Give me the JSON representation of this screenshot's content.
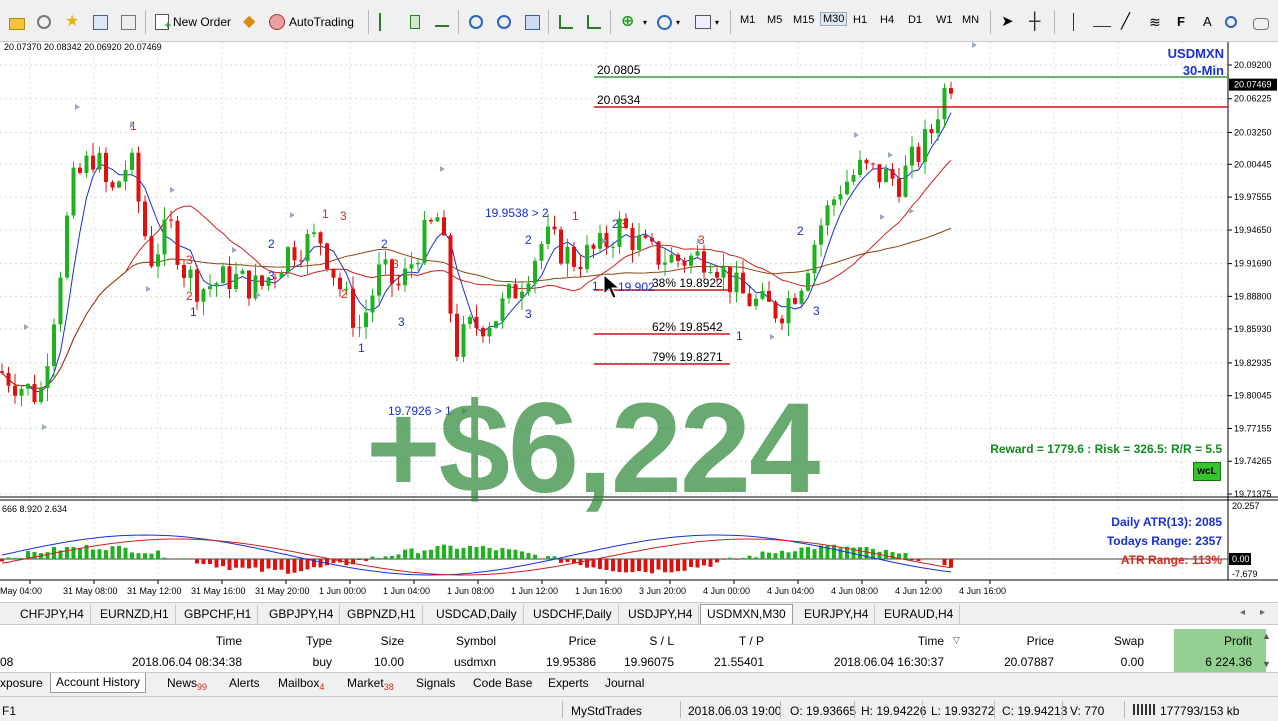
{
  "toolbar": {
    "new_order_label": "New Order",
    "autotrading_label": "AutoTrading",
    "timeframes": [
      "M1",
      "M5",
      "M15",
      "M30",
      "H1",
      "H4",
      "D1",
      "W1",
      "MN"
    ],
    "selected_timeframe": "M30"
  },
  "chart": {
    "ohlc_header": "20.07370 20.08342 20.06920 20.07469",
    "symbol": "USDMXN",
    "timeframe_label": "30-Min",
    "current_price_tag": "20.07469",
    "price_axis": [
      "20.09200",
      "20.06225",
      "20.03250",
      "20.00445",
      "19.97555",
      "19.94650",
      "19.91690",
      "19.88800",
      "19.85930",
      "19.82935",
      "19.80045",
      "19.77155",
      "19.74265",
      "19.71375"
    ],
    "time_axis": [
      "31 May 04:00",
      "31 May 08:00",
      "31 May 12:00",
      "31 May 16:00",
      "31 May 20:00",
      "1 Jun 00:00",
      "1 Jun 04:00",
      "1 Jun 08:00",
      "1 Jun 12:00",
      "1 Jun 16:00",
      "3 Jun 20:00",
      "4 Jun 00:00",
      "4 Jun 04:00",
      "4 Jun 08:00",
      "4 Jun 12:00",
      "4 Jun 16:00"
    ],
    "level_tp": "20.0805",
    "level_entry": "20.0534",
    "fib_38": "38% 19.8922",
    "fib_62": "62% 19.8542",
    "fib_79": "79% 19.8271",
    "label_high": "19.9538 > 2",
    "label_low": "19.7926 > 1",
    "label_mid": "19.902",
    "profit_overlay": "+$6,224",
    "reward_risk": "Reward = 1779.6 : Risk = 326.5: R/R = 5.5",
    "badge": "wcL",
    "atr_line1": "Daily ATR(13): 2085",
    "atr_line2": "Todays Range: 2357",
    "atr_line3": "ATR Range: 113%",
    "indicator_label": "666 8.920 2.634",
    "indicator_axis": [
      "20.257",
      "0.00",
      "-7.679"
    ],
    "wave_labels": [
      {
        "t": "1",
        "c": "red"
      },
      {
        "t": "2",
        "c": "red"
      },
      {
        "t": "3",
        "c": "red"
      },
      {
        "t": "1",
        "c": "blue"
      },
      {
        "t": "2",
        "c": "blue"
      },
      {
        "t": "3",
        "c": "blue"
      }
    ]
  },
  "chart_tabs": [
    "CHFJPY,H4",
    "EURNZD,H1",
    "GBPCHF,H1",
    "GBPJPY,H4",
    "GBPNZD,H1",
    "USDCAD,Daily",
    "USDCHF,Daily",
    "USDJPY,H4",
    "USDMXN,M30",
    "EURJPY,H4",
    "EURAUD,H4"
  ],
  "active_chart_tab": "USDMXN,M30",
  "terminal": {
    "headers": {
      "time": "Time",
      "type": "Type",
      "size": "Size",
      "symbol": "Symbol",
      "price": "Price",
      "sl": "S / L",
      "tp": "T / P",
      "time2": "Time",
      "price2": "Price",
      "swap": "Swap",
      "profit": "Profit"
    },
    "row": {
      "id": "08",
      "time": "2018.06.04 08:34:38",
      "type": "buy",
      "size": "10.00",
      "symbol": "usdmxn",
      "price": "19.95386",
      "sl": "19.96075",
      "tp": "21.55401",
      "time2": "2018.06.04 16:30:37",
      "price2": "20.07887",
      "swap": "0.00",
      "profit": "6 224.36"
    }
  },
  "bottom_tabs": {
    "exposure": "xposure",
    "account_history": "Account History",
    "news": "News",
    "news_count": "99",
    "alerts": "Alerts",
    "mailbox": "Mailbox",
    "mailbox_count": "4",
    "market": "Market",
    "market_count": "38",
    "signals": "Signals",
    "code_base": "Code Base",
    "experts": "Experts",
    "journal": "Journal"
  },
  "status": {
    "help": "F1",
    "profile": "MyStdTrades",
    "datetime": "2018.06.03 19:00",
    "open": "O: 19.93665",
    "high": "H: 19.94226",
    "low": "L: 19.93272",
    "close": "C: 19.94213",
    "volume": "V: 770",
    "traffic": "177793/153 kb"
  },
  "colors": {
    "bull": "#1fb21f",
    "bear": "#e01010",
    "ma_blue": "#1a2fd6",
    "ma_red": "#cc2020",
    "ma_brown": "#8b4513",
    "tp_line": "#3a9a3a",
    "entry_line": "#d01010"
  }
}
